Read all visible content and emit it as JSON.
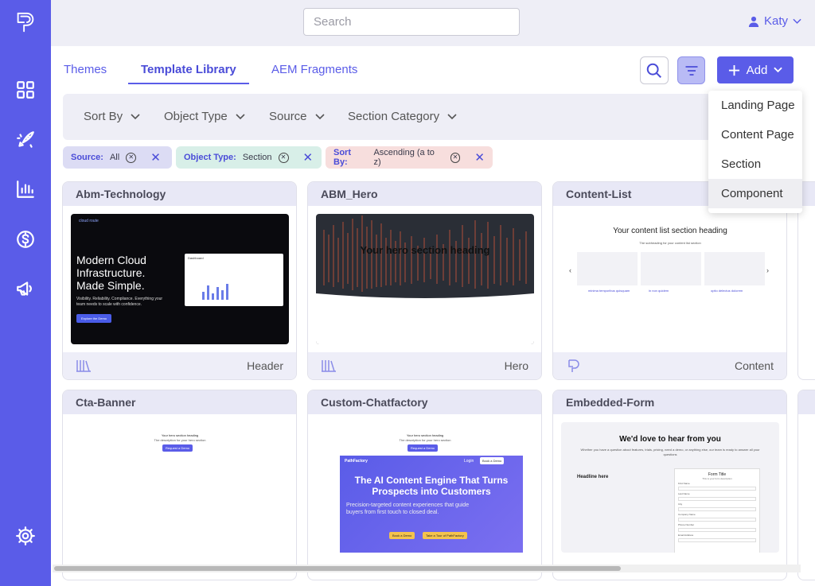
{
  "sidebar": {
    "items": [
      {
        "icon": "logo-icon"
      },
      {
        "icon": "grid-icon"
      },
      {
        "icon": "rocket-icon"
      },
      {
        "icon": "bar-chart-icon"
      },
      {
        "icon": "dollar-icon"
      },
      {
        "icon": "megaphone-icon"
      },
      {
        "icon": "gear-icon"
      }
    ]
  },
  "header": {
    "search_placeholder": "Search",
    "user_name": "Katy"
  },
  "tabs": [
    {
      "label": "Themes"
    },
    {
      "label": "Template Library"
    },
    {
      "label": "AEM Fragments"
    }
  ],
  "toolbar": {
    "add_label": "Add"
  },
  "add_menu": {
    "items": [
      "Landing Page",
      "Content Page",
      "Section",
      "Component"
    ]
  },
  "filters": {
    "items": [
      "Sort By",
      "Object Type",
      "Source",
      "Section Category"
    ]
  },
  "chips": [
    {
      "key": "Source:",
      "value": "All"
    },
    {
      "key": "Object Type:",
      "value": "Section"
    },
    {
      "key": "Sort By:",
      "value": "Ascending (a to z)"
    }
  ],
  "cards": [
    {
      "title": "Abm-Technology",
      "category": "Header",
      "preview": {
        "brand": "cloud route",
        "headline": "Modern Cloud Infrastructure. Made Simple.",
        "subtext": "Visibility. Reliability. Compliance. Everything your team needs to scale with confidence.",
        "cta": "Explore the Demo",
        "dash_title": "Dashboard"
      }
    },
    {
      "title": "ABM_Hero",
      "category": "Hero",
      "preview": {
        "heading": "Your hero section heading"
      }
    },
    {
      "title": "Content-List",
      "category": "Content",
      "preview": {
        "heading": "Your content list section heading",
        "sub": "The subheading for your content list section",
        "links": [
          "minima temporibus quisquam",
          "in non quidem",
          "optio delectus dolorem"
        ]
      }
    },
    {
      "title": "Cta-Banner",
      "preview": {
        "heading": "Your hero section heading",
        "sub": "The description for your hero section",
        "cta": "Request a Demo"
      }
    },
    {
      "title": "Custom-Chatfactory",
      "preview": {
        "heading": "Your hero section heading",
        "sub": "The description for your hero section",
        "cta": "Request a Demo",
        "brand": "PathFactory",
        "login": "Login",
        "book": "Book a Demo",
        "headline": "The AI Content Engine That Turns Prospects into Customers",
        "body": "Precision-targeted content experiences that guide buyers from first touch to closed deal.",
        "btn1": "Book a Demo",
        "btn2": "Take a Tour of PathFactory"
      }
    },
    {
      "title": "Embedded-Form",
      "preview": {
        "heading": "We'd love to hear from you",
        "sub": "Whether you have a question about features, trials, pricing, need a demo, or anything else, our team is ready to answer all your questions",
        "left_heading": "Headline here",
        "form_title": "Form Title",
        "form_sub": "This is your form description",
        "fields": [
          "First Name",
          "Last Name",
          "City",
          "Company Name",
          "Phone Number",
          "Email Address"
        ]
      }
    }
  ],
  "colors": {
    "accent": "#5a5ce8",
    "chip_source": "#dcdcf4",
    "chip_type": "#d8efe8",
    "chip_sort": "#f7dedd"
  }
}
